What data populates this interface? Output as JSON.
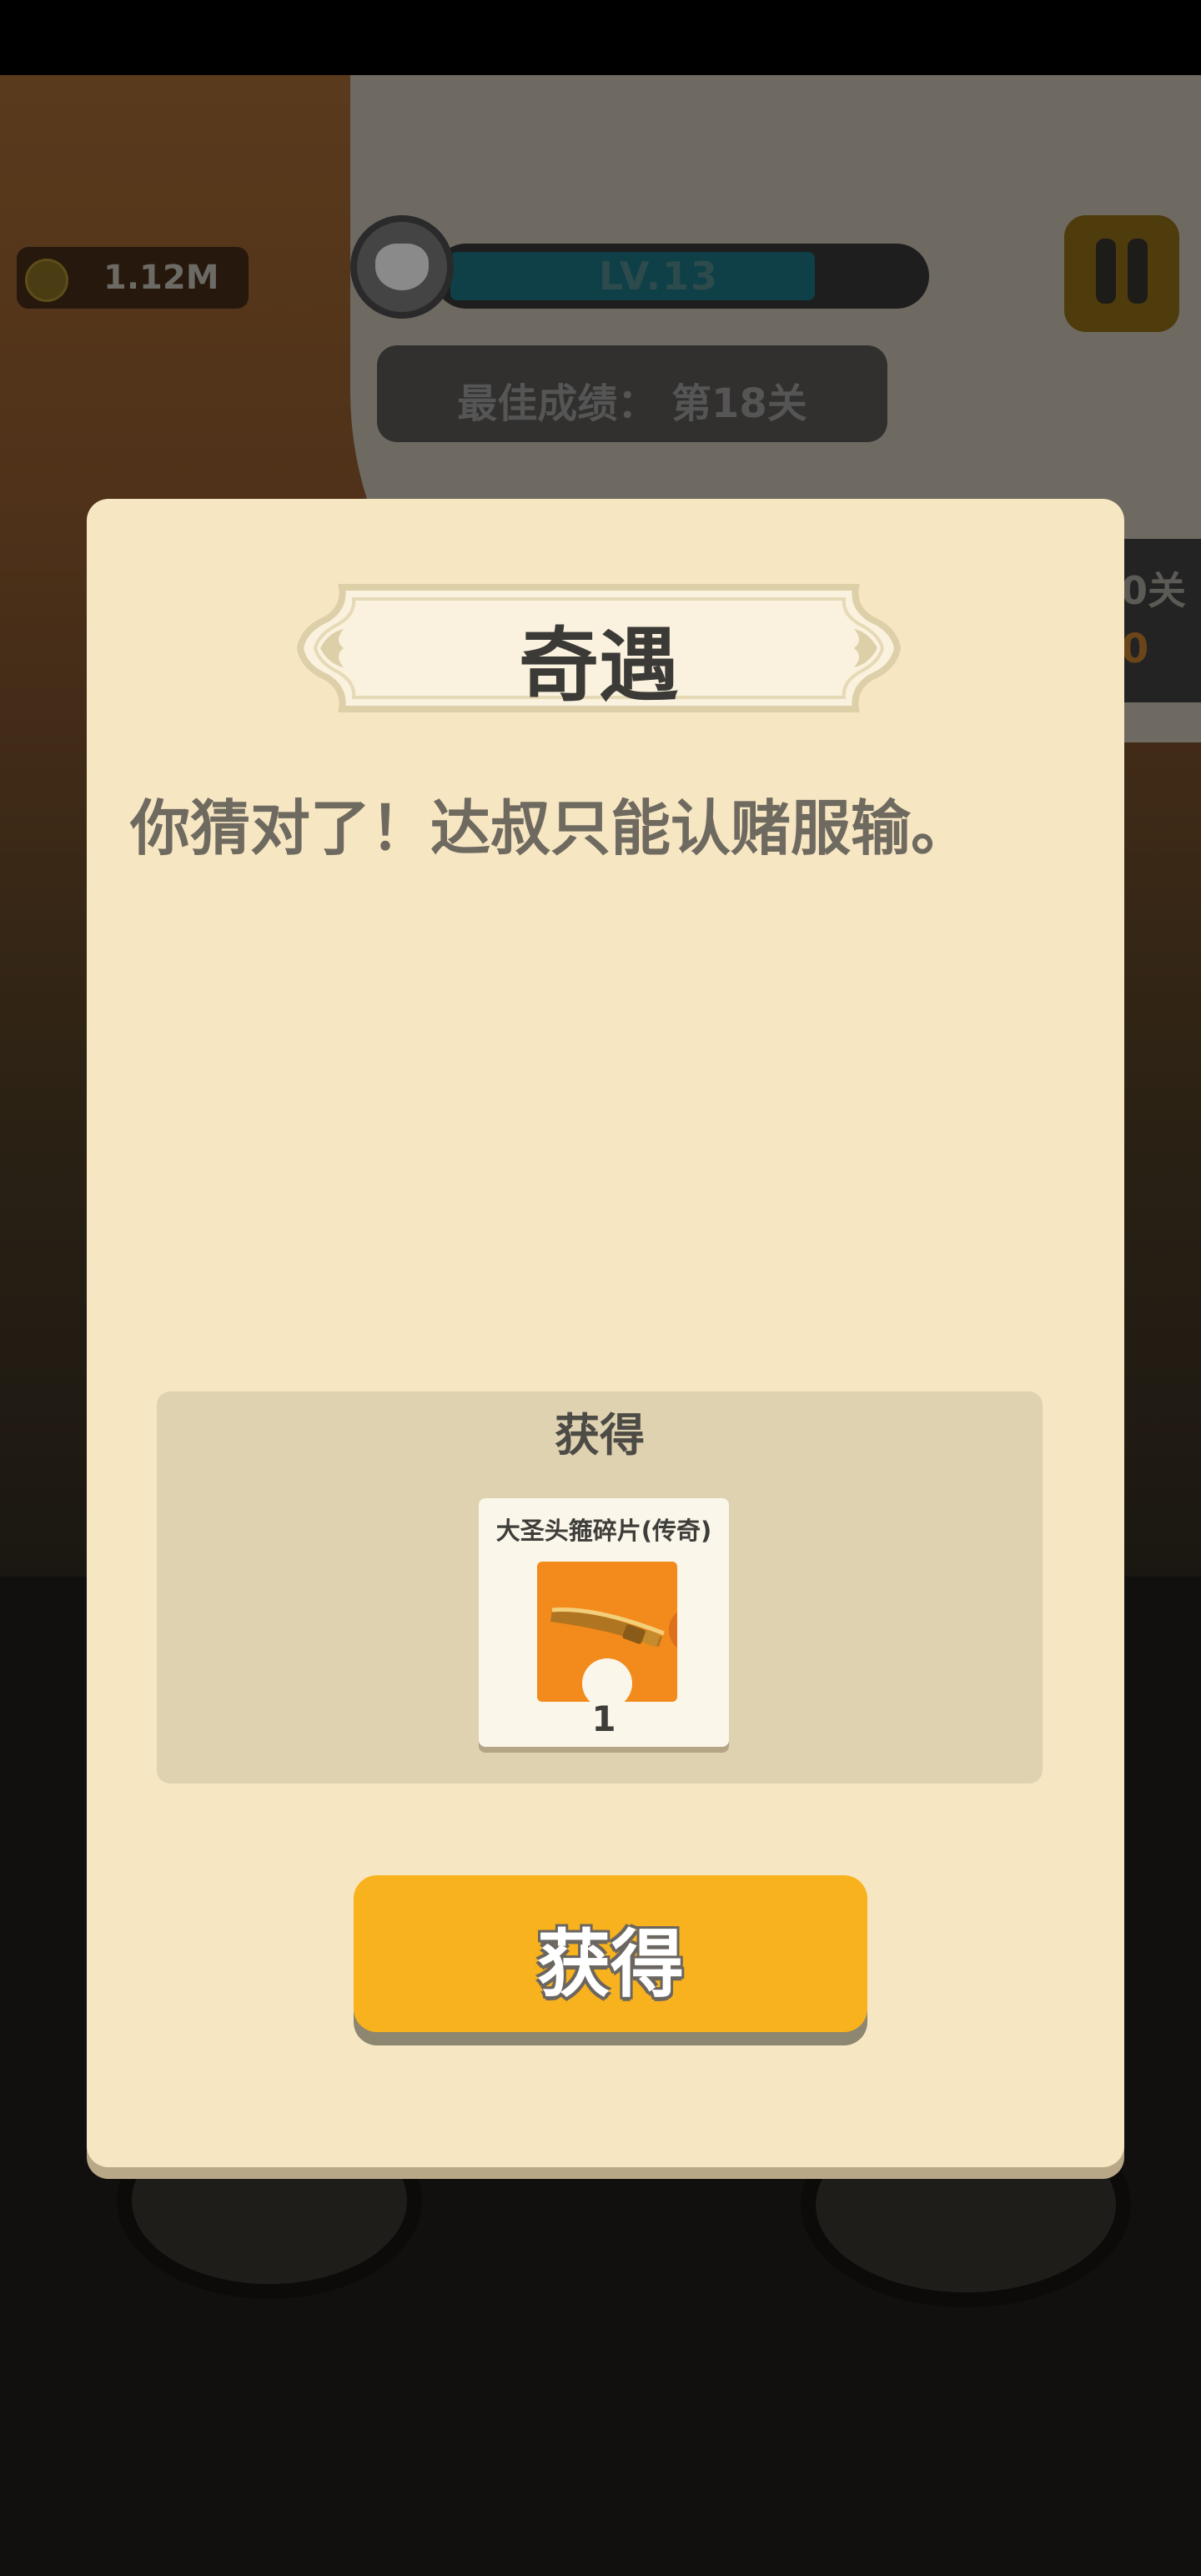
{
  "hud": {
    "coins": "1.12M",
    "level": "LV.13",
    "level_progress": 0.78,
    "best_score": "最佳成绩： 第18关",
    "side_top": "0关",
    "side_bottom": "0"
  },
  "dialog": {
    "title": "奇遇",
    "message": "你猜对了！达叔只能认赌服输。",
    "reward_section_title": "获得",
    "reward": {
      "name": "大圣头箍碎片(传奇)",
      "count": "1",
      "icon": "golden-headband-fragment-icon"
    },
    "get_button_label": "获得"
  },
  "colors": {
    "dialog_bg": "#f7e6c2",
    "button": "#f8b21e",
    "reward_icon_bg": "#f28a1c"
  }
}
